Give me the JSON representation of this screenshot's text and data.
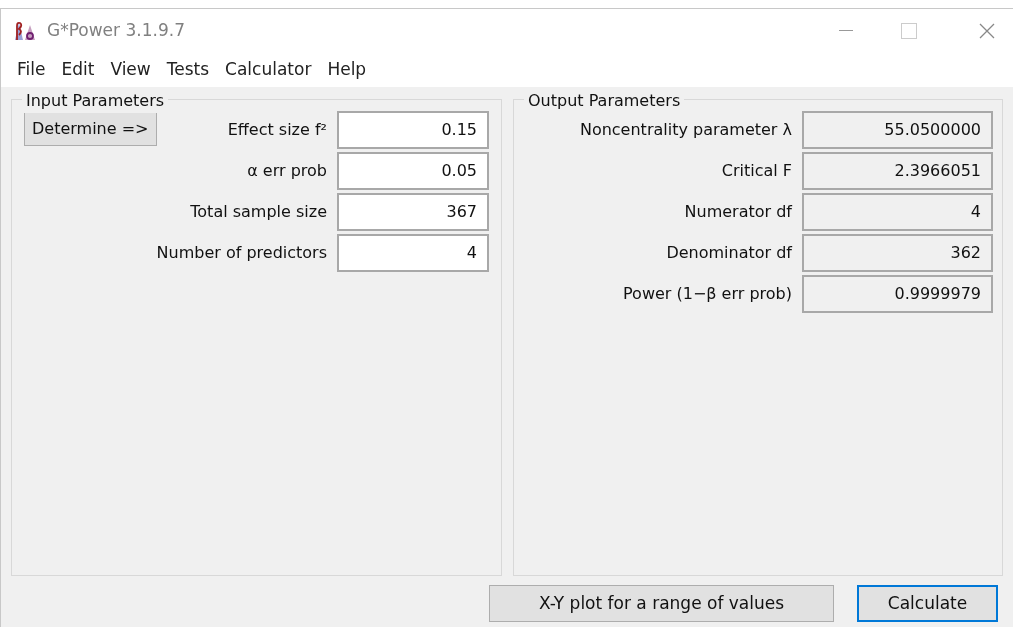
{
  "window": {
    "title": "G*Power 3.1.9.7"
  },
  "menu": [
    "File",
    "Edit",
    "View",
    "Tests",
    "Calculator",
    "Help"
  ],
  "input_parameters": {
    "title": "Input Parameters",
    "determine_button": "Determine =>",
    "fields": [
      {
        "label": "Effect size f²",
        "value": "0.15"
      },
      {
        "label": "α err prob",
        "value": "0.05"
      },
      {
        "label": "Total sample size",
        "value": "367"
      },
      {
        "label": "Number of predictors",
        "value": "4"
      }
    ]
  },
  "output_parameters": {
    "title": "Output Parameters",
    "fields": [
      {
        "label": "Noncentrality parameter λ",
        "value": "55.0500000"
      },
      {
        "label": "Critical F",
        "value": "2.3966051"
      },
      {
        "label": "Numerator df",
        "value": "4"
      },
      {
        "label": "Denominator df",
        "value": "362"
      },
      {
        "label": "Power (1−β err prob)",
        "value": "0.9999979"
      }
    ]
  },
  "buttons": [
    {
      "label": "X-Y plot for a range of values",
      "focused": false
    },
    {
      "label": "Calculate",
      "focused": true
    }
  ]
}
